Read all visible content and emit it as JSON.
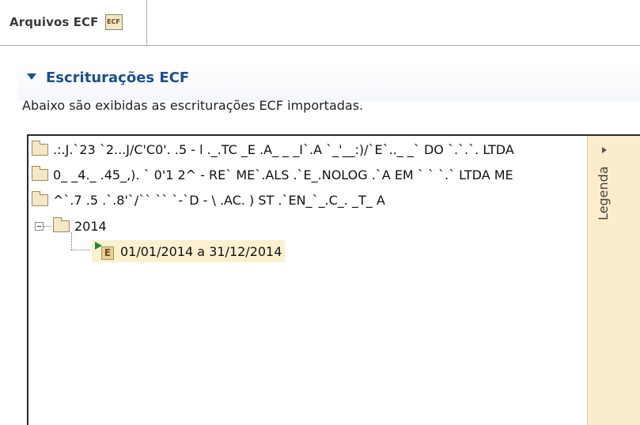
{
  "tab": {
    "label": "Arquivos ECF",
    "icon_text": "ECF"
  },
  "section": {
    "title": "Escriturações ECF",
    "description": "Abaixo são exibidas as escriturações ECF importadas."
  },
  "tree": {
    "items": [
      {
        "label": ".:.J.`23 `2...J/C'C0'. .5 - l ._.TC _E .A_ _ _I`.A `_'__:)/`E`.._ _` DO `.`.`. LTDA"
      },
      {
        "label": "0_ _4._ .45_,). ` 0'1 2^ - RE` ME`.ALS .`E_.NOLOG .`A EM `  `  `.` LTDA ME"
      },
      {
        "label": "^`.7 .5 .`.8'`/`` `` `-`D - \\ .AC. ) ST .`EN_`_.C_. _T_ A"
      },
      {
        "label": "2014"
      }
    ],
    "child": {
      "label": "01/01/2014 a 31/12/2014",
      "icon_text": "E"
    }
  },
  "legend": {
    "label": "Legenda"
  },
  "colors": {
    "accent": "#1d4f8c",
    "selection": "#fbf1cf",
    "legend_bg": "#fbeccb",
    "folder": "#f4e7c6"
  }
}
